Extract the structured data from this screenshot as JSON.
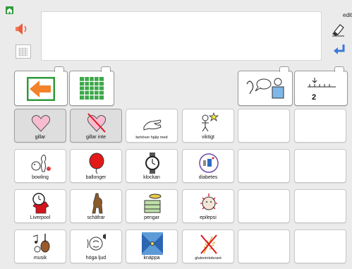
{
  "toolbar": {
    "home_icon": "home-icon",
    "speaker_icon": "speaker-icon",
    "keyboard_icon": "keyboard-grid-icon",
    "edit_label": "edit",
    "eraser_icon": "eraser-icon",
    "enter_icon": "enter-arrow-icon"
  },
  "message": {
    "text": ""
  },
  "nav": {
    "back_icon": "back-arrow-icon",
    "grid_icon": "grid-icon",
    "talk_icon": "speech-person-icon",
    "number_icon": "number-line-icon",
    "number_label": "2"
  },
  "grid": {
    "rows": [
      [
        {
          "label": "gillar",
          "icon": "heart-icon",
          "selected": true
        },
        {
          "label": "gillar inte",
          "icon": "crossed-heart-icon",
          "selected": true
        },
        {
          "label": "behöver hjälp med",
          "icon": "helping-hand-icon",
          "selected": false
        },
        {
          "label": "viktigt",
          "icon": "important-person-icon",
          "selected": false
        },
        {
          "label": "",
          "icon": "",
          "selected": false
        },
        {
          "label": "",
          "icon": "",
          "selected": false
        }
      ],
      [
        {
          "label": "bowling",
          "icon": "bowling-icon",
          "selected": false
        },
        {
          "label": "ballonger",
          "icon": "balloon-icon",
          "selected": false
        },
        {
          "label": "klockan",
          "icon": "watch-icon",
          "selected": false
        },
        {
          "label": "diabetes",
          "icon": "diabetes-icon",
          "selected": false
        },
        {
          "label": "",
          "icon": "",
          "selected": false
        },
        {
          "label": "",
          "icon": "",
          "selected": false
        }
      ],
      [
        {
          "label": "Liverpool",
          "icon": "liverpool-icon",
          "selected": false
        },
        {
          "label": "schäfrar",
          "icon": "dog-icon",
          "selected": false
        },
        {
          "label": "pengar",
          "icon": "money-icon",
          "selected": false
        },
        {
          "label": "epilepsi",
          "icon": "epilepsy-icon",
          "selected": false
        },
        {
          "label": "",
          "icon": "",
          "selected": false
        },
        {
          "label": "",
          "icon": "",
          "selected": false
        }
      ],
      [
        {
          "label": "musik",
          "icon": "music-icon",
          "selected": false
        },
        {
          "label": "höga ljud",
          "icon": "loud-noise-icon",
          "selected": false
        },
        {
          "label": "knäppa",
          "icon": "button-up-icon",
          "selected": false
        },
        {
          "label": "glutenintolerant",
          "icon": "gluten-icon",
          "selected": false
        },
        {
          "label": "",
          "icon": "",
          "selected": false
        },
        {
          "label": "",
          "icon": "",
          "selected": false
        }
      ]
    ]
  }
}
